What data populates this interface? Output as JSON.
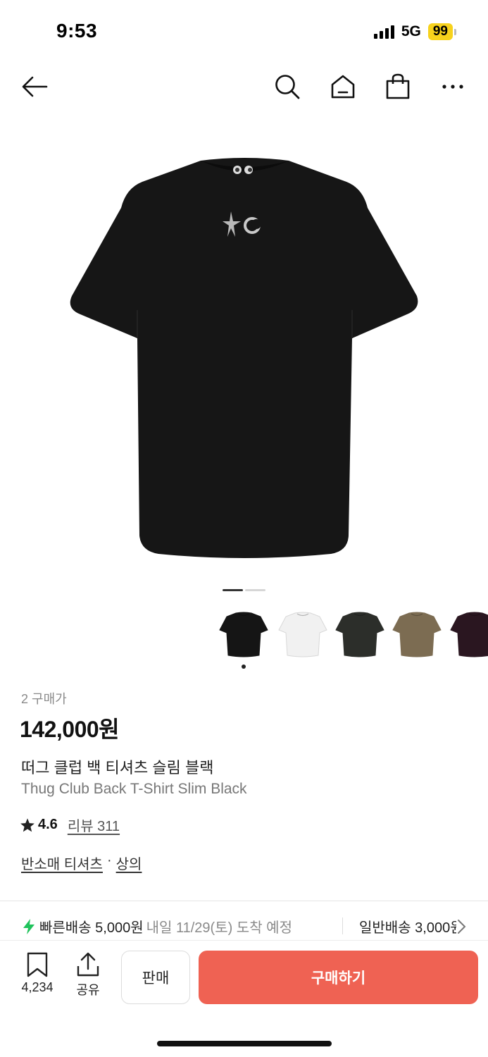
{
  "status_bar": {
    "time": "9:53",
    "network": "5G",
    "battery": "99"
  },
  "nav": {
    "back_icon": "arrow-left-icon",
    "search_icon": "search-icon",
    "home_icon": "home-icon",
    "bag_icon": "shopping-bag-icon",
    "more_icon": "more-horizontal-icon"
  },
  "gallery": {
    "current_page": 1,
    "total_pages": 2
  },
  "color_options": [
    {
      "color": "#151515"
    },
    {
      "color": "#f1f1f1"
    },
    {
      "color": "#2c2e2a"
    },
    {
      "color": "#7c6c52"
    },
    {
      "color": "#2a1620"
    }
  ],
  "product": {
    "buyers": "2 구매가",
    "price": "142,000원",
    "name_ko": "떠그 클럽 백 티셔츠 슬림 블랙",
    "name_en": "Thug Club Back T-Shirt Slim Black",
    "rating": "4.6",
    "review_link": "리뷰 311",
    "category_primary": "반소매 티셔츠",
    "category_separator": "·",
    "category_secondary": "상의"
  },
  "shipping": {
    "fast_label": "빠른배송 5,000원",
    "fast_eta": "내일 11/29(토) 도착 예정",
    "normal_label": "일반배송 3,000원"
  },
  "bottom_bar": {
    "bookmark_count": "4,234",
    "share_label": "공유",
    "sell_label": "판매",
    "buy_label": "구매하기"
  },
  "colors": {
    "accent": "#ef6253",
    "fast_shipping": "#20c35c",
    "battery": "#f7d21c"
  }
}
